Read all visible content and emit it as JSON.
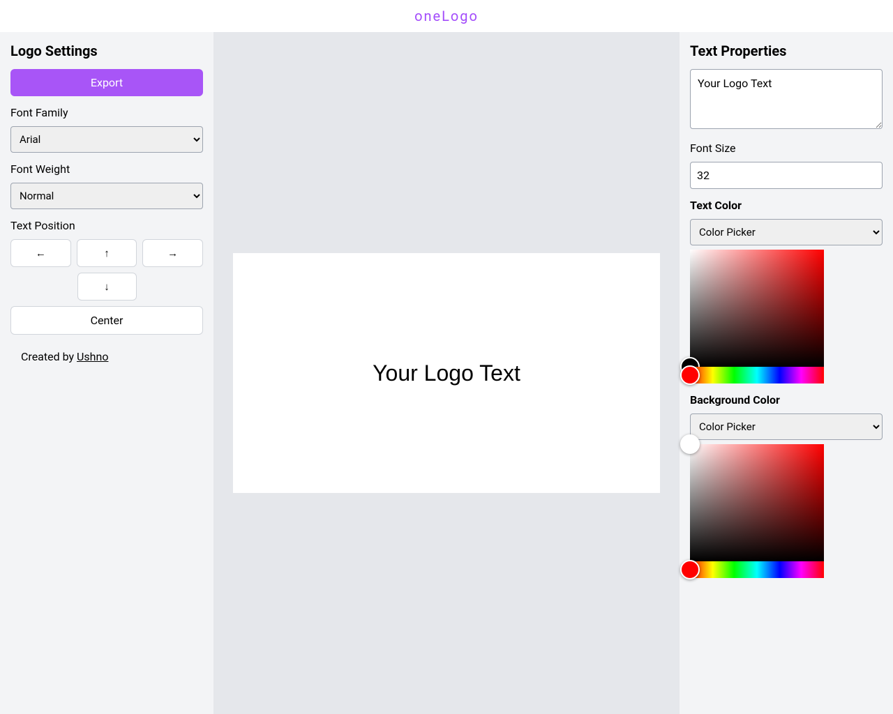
{
  "header": {
    "title": "oneLogo"
  },
  "leftPanel": {
    "title": "Logo Settings",
    "exportLabel": "Export",
    "fontFamilyLabel": "Font Family",
    "fontFamilyValue": "Arial",
    "fontWeightLabel": "Font Weight",
    "fontWeightValue": "Normal",
    "textPositionLabel": "Text Position",
    "arrows": {
      "left": "←",
      "up": "↑",
      "right": "→",
      "down": "↓"
    },
    "centerLabel": "Center",
    "creditPrefix": "Created by ",
    "creditName": "Ushno"
  },
  "canvas": {
    "text": "Your Logo Text"
  },
  "rightPanel": {
    "title": "Text Properties",
    "textareaValue": "Your Logo Text",
    "fontSizeLabel": "Font Size",
    "fontSizeValue": "32",
    "textColorLabel": "Text Color",
    "textColorMode": "Color Picker",
    "textColorValue": "#000000",
    "bgColorLabel": "Background Color",
    "bgColorMode": "Color Picker",
    "bgColorValue": "#ffffff"
  }
}
